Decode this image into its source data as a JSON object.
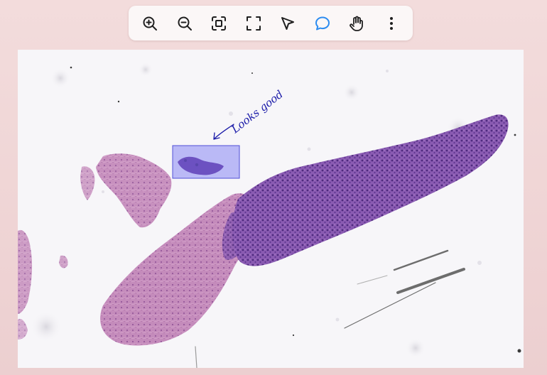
{
  "toolbar": {
    "tools": [
      {
        "name": "zoom-in",
        "icon": "zoom-in-icon",
        "active": false
      },
      {
        "name": "zoom-out",
        "icon": "zoom-out-icon",
        "active": false
      },
      {
        "name": "fit-to-screen",
        "icon": "fit-icon",
        "active": false
      },
      {
        "name": "fullscreen",
        "icon": "fullscreen-icon",
        "active": false
      },
      {
        "name": "select",
        "icon": "pointer-icon",
        "active": false
      },
      {
        "name": "comment",
        "icon": "comment-icon",
        "active": true
      },
      {
        "name": "pan",
        "icon": "hand-icon",
        "active": false
      },
      {
        "name": "more",
        "icon": "more-vertical-icon",
        "active": false
      }
    ],
    "active_color": "#2d8cf0",
    "icon_color": "#1f1f1f"
  },
  "annotation": {
    "handwritten_note": "Looks good",
    "note_color": "#1a1aa8",
    "box_color": "#6f6ff2"
  },
  "slide": {
    "tissue_dark": "#7a4aa8",
    "tissue_light": "#c58ab8"
  }
}
